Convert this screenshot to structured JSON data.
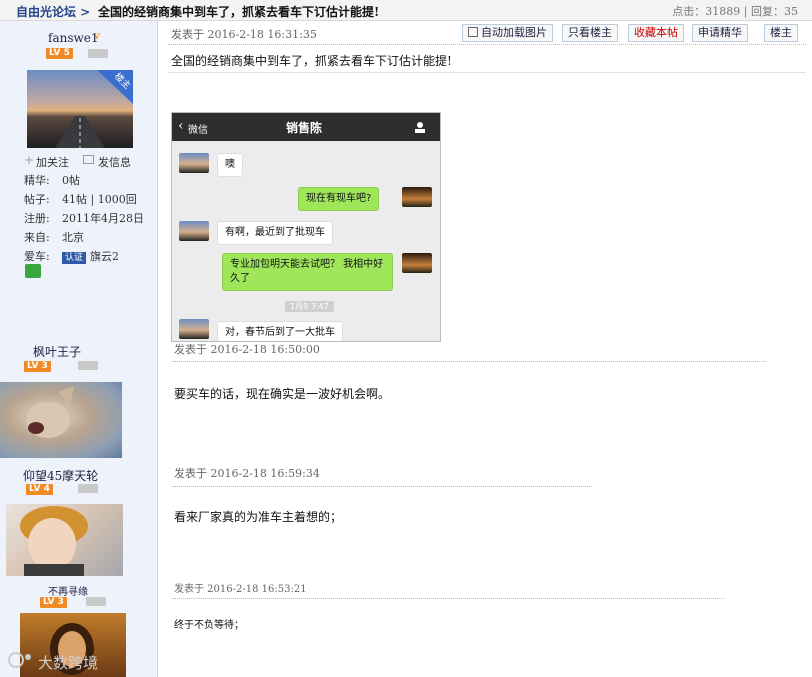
{
  "topbar": {
    "breadcrumb": "自由光论坛 >",
    "thread_title": "全国的经销商集中到车了，抓紧去看车下订估计能提!",
    "stats": "点击：31889 | 回复：35"
  },
  "posts": [
    {
      "author": {
        "name": "fanswe1",
        "level": "LV 5",
        "floor_badge": "楼主",
        "follow": "加关注",
        "message": "发信息",
        "info": [
          {
            "k": "精华:",
            "v": "0帖"
          },
          {
            "k": "帖子:",
            "v": "41帖 | 1000回"
          },
          {
            "k": "注册:",
            "v": "2011年4月28日"
          },
          {
            "k": "来自:",
            "v": "北京"
          },
          {
            "k": "爱车:",
            "v": "旗云2"
          }
        ],
        "cert_label": "认证"
      },
      "toolbar": {
        "posted_at": "发表于 2016-2-18 16:31:35",
        "autoload": "自动加载图片",
        "only_op": "只看楼主",
        "favorite": "收藏本帖",
        "apply_digest": "申请精华",
        "floor": "楼主"
      },
      "text": "全国的经销商集中到车了，抓紧去看车下订估计能提!",
      "chat": {
        "back": "微信",
        "contact": "销售陈",
        "messages": [
          {
            "side": "left",
            "text": "噢"
          },
          {
            "side": "right",
            "text": "现在有现车吧?"
          },
          {
            "side": "left",
            "text": "有啊，最近到了批现车"
          },
          {
            "side": "right",
            "text": "专业加包明天能去试吧？ 我相中好久了"
          },
          {
            "side": "left",
            "text": "对，春节后到了一大批车"
          }
        ],
        "timestamp": "1月9 3:47"
      }
    },
    {
      "author": {
        "name": "枫叶王子",
        "level": "LV 3"
      },
      "posted_at": "发表于 2016-2-18 16:50:00",
      "text": "要买车的话，现在确实是一波好机会啊。"
    },
    {
      "author": {
        "name": "仰望45摩天轮",
        "level": "LV 4"
      },
      "posted_at": "发表于 2016-2-18 16:59:34",
      "text": "看来厂家真的为准车主着想的；"
    },
    {
      "author": {
        "name": "不再寻缘",
        "level": "LV 3"
      },
      "posted_at": "发表于 2016-2-18 16:53:21",
      "text": "终于不负等待；"
    }
  ],
  "watermark": "大数跨境",
  "colors": {
    "accent": "#224488",
    "level_badge": "#f08a24",
    "favorite_red": "#cc0000",
    "wechat_green": "#9fe65b"
  }
}
